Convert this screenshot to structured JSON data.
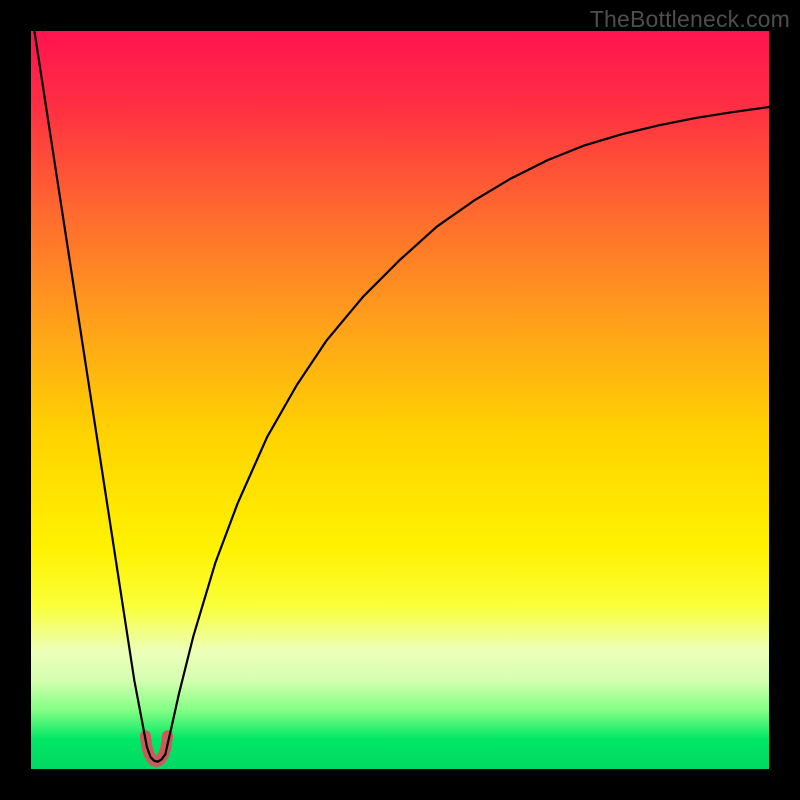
{
  "watermark": "TheBottleneck.com",
  "chart_data": {
    "type": "line",
    "title": "",
    "xlabel": "",
    "ylabel": "",
    "xlim": [
      0,
      100
    ],
    "ylim": [
      0,
      100
    ],
    "grid": false,
    "legend": false,
    "series": [
      {
        "name": "left-branch",
        "x": [
          0,
          2,
          4,
          6,
          8,
          10,
          12,
          14,
          15.7,
          16.2,
          16.7,
          17.2,
          17.7,
          18.2
        ],
        "y": [
          103,
          90,
          77,
          64,
          51,
          38,
          25,
          12,
          3,
          1.6,
          1.1,
          1.0,
          1.3,
          2.0
        ]
      },
      {
        "name": "right-branch",
        "x": [
          18.2,
          19,
          20,
          22,
          25,
          28,
          32,
          36,
          40,
          45,
          50,
          55,
          60,
          65,
          70,
          75,
          80,
          85,
          90,
          95,
          100
        ],
        "y": [
          2.0,
          5.5,
          10,
          18,
          28,
          36,
          45,
          52,
          58,
          64,
          69,
          73.5,
          77,
          80,
          82.5,
          84.5,
          86,
          87.2,
          88.2,
          89,
          89.7
        ]
      },
      {
        "name": "dip-marker",
        "x": [
          15.5,
          15.7,
          16.0,
          16.5,
          17.0,
          17.5,
          18.0,
          18.3,
          18.5
        ],
        "y": [
          4.5,
          3.0,
          2.0,
          1.2,
          1.0,
          1.2,
          2.0,
          3.0,
          4.5
        ]
      }
    ],
    "gradient_stops": [
      {
        "offset": 0.0,
        "color": "#ff1450"
      },
      {
        "offset": 0.1,
        "color": "#ff2e43"
      },
      {
        "offset": 0.25,
        "color": "#ff6b2e"
      },
      {
        "offset": 0.4,
        "color": "#ffa21a"
      },
      {
        "offset": 0.55,
        "color": "#ffd400"
      },
      {
        "offset": 0.7,
        "color": "#fff200"
      },
      {
        "offset": 0.78,
        "color": "#f9ff3a"
      },
      {
        "offset": 0.84,
        "color": "#edffb9"
      },
      {
        "offset": 0.88,
        "color": "#d4ffb0"
      },
      {
        "offset": 0.92,
        "color": "#84ff84"
      },
      {
        "offset": 0.96,
        "color": "#00e765"
      },
      {
        "offset": 1.0,
        "color": "#00d964"
      }
    ],
    "background_band": {
      "ymin": 0,
      "ymax": 100
    },
    "curve_stroke": "#000000",
    "curve_width": 2.2,
    "dip_stroke": "#cc5a5a",
    "dip_width": 11
  }
}
